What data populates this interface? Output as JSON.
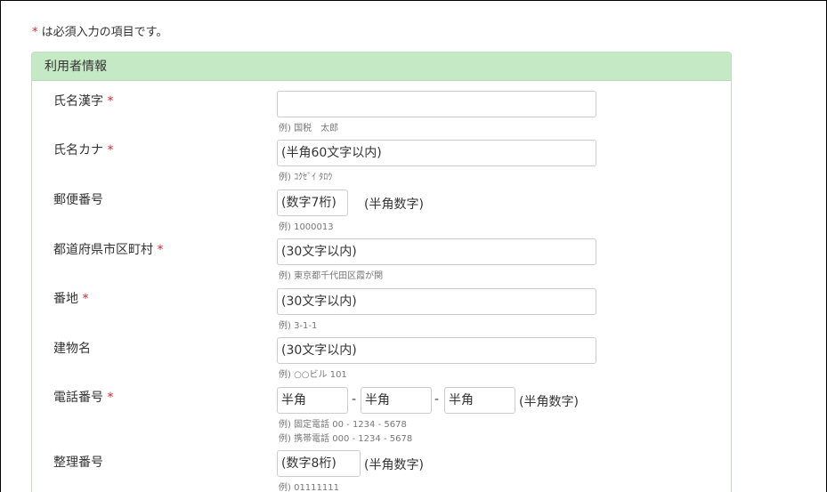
{
  "required_note": {
    "marker": "*",
    "text": " は必須入力の項目です。"
  },
  "section": {
    "title": "利用者情報"
  },
  "fields": {
    "name_kanji": {
      "label": "氏名漢字",
      "required": "*",
      "value": "",
      "example": "例) 国税　太郎"
    },
    "name_kana": {
      "label": "氏名カナ",
      "required": "*",
      "placeholder": "(半角60文字以内)",
      "example": "例) ｺｸｾﾞｲ ﾀﾛｳ"
    },
    "postal": {
      "label": "郵便番号",
      "placeholder": "(数字7桁)",
      "suffix": "(半角数字)",
      "example": "例) 1000013"
    },
    "prefecture_city": {
      "label": "都道府県市区町村",
      "required": "*",
      "placeholder": "(30文字以内)",
      "example": "例) 東京都千代田区霞が関"
    },
    "address_number": {
      "label": "番地",
      "required": "*",
      "placeholder": "(30文字以内)",
      "example": "例) 3-1-1"
    },
    "building": {
      "label": "建物名",
      "placeholder": "(30文字以内)",
      "example": "例) ○○ビル 101"
    },
    "phone": {
      "label": "電話番号",
      "required": "*",
      "placeholder1": "半角",
      "placeholder2": "半角",
      "placeholder3": "半角",
      "separator": "-",
      "suffix": "(半角数字)",
      "example1": "例) 固定電話 00 - 1234 - 5678",
      "example2": "例) 携帯電話 000 - 1234 - 5678"
    },
    "reference_number": {
      "label": "整理番号",
      "placeholder": "(数字8桁)",
      "suffix": "(半角数字)",
      "example": "例) 01111111"
    }
  }
}
